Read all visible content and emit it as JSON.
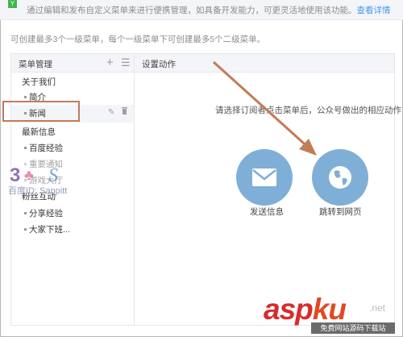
{
  "notice": {
    "badge": "Y",
    "text": "通过编辑和发布自定义菜单来进行便携管理，如具备开发能力，可更灵活地使用该功能。",
    "link": "查看详情"
  },
  "hint": "可创建最多3个一级菜单，每个一级菜单下可创建最多5个二级菜单。",
  "sidebar": {
    "title": "菜单管理",
    "items": [
      {
        "label": "关于我们",
        "level": 1
      },
      {
        "label": "简介",
        "level": 2
      },
      {
        "label": "新闻",
        "level": 2,
        "selected": true
      },
      {
        "label": "最新信息",
        "level": 1
      },
      {
        "label": "百度经验",
        "level": 2
      },
      {
        "label": "重要通知",
        "level": 2
      },
      {
        "label": "游戏大厅",
        "level": 2
      },
      {
        "label": "粉丝互动",
        "level": 1
      },
      {
        "label": "分享经验",
        "level": 2
      },
      {
        "label": "大家下班...",
        "level": 2
      }
    ]
  },
  "main": {
    "title": "设置动作",
    "description": "请选择订阅者点击菜单后，公众号做出的相应动作",
    "actions": [
      {
        "label": "发送信息",
        "icon": "envelope-icon"
      },
      {
        "label": "跳转到网页",
        "icon": "globe-icon"
      }
    ]
  },
  "watermark": {
    "id_text": "百度ID: Sanpitt"
  },
  "site_logo": {
    "asp": "asp",
    "ku": "ku",
    "suffix": ".net",
    "subtitle": "免费网站源码下载站"
  },
  "colors": {
    "accent": "#44b549",
    "link": "#459ae9",
    "action_circle": "#7fafd7",
    "annotation": "#c27c56",
    "logo": "#d92b2b"
  }
}
